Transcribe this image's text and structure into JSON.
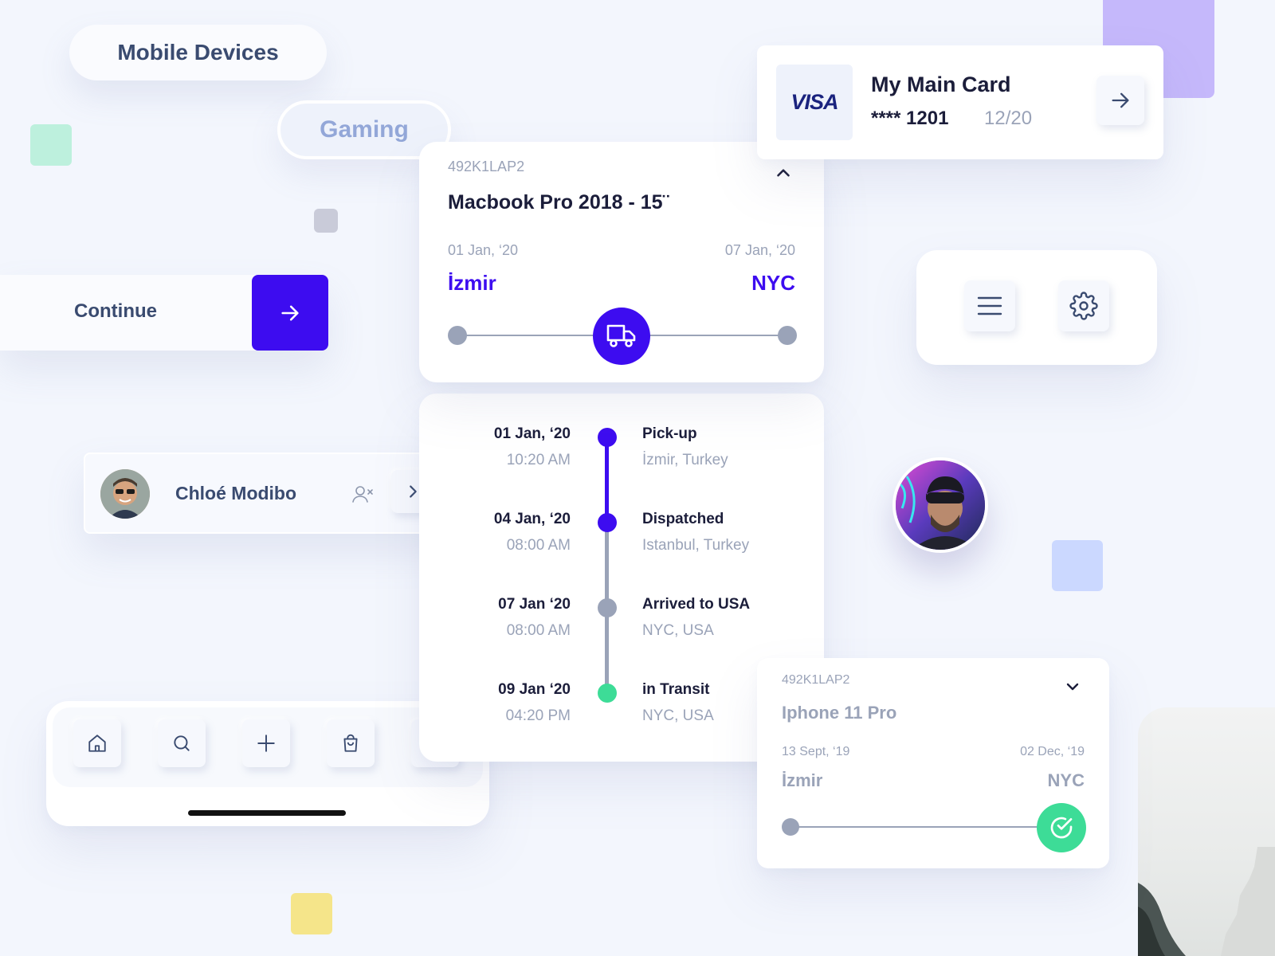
{
  "chips": {
    "mobile_devices": "Mobile Devices",
    "gaming": "Gaming"
  },
  "continue_button": {
    "label": "Continue"
  },
  "user_row": {
    "name": "Chloé Modibo"
  },
  "card_widget": {
    "brand": "VISA",
    "title": "My Main Card",
    "number": "**** 1201",
    "expiry": "12/20"
  },
  "shipment_main": {
    "code": "492K1LAP2",
    "product": "Macbook Pro 2018 - 15¨",
    "start_date": "01 Jan, ‘20",
    "end_date": "07 Jan, ‘20",
    "origin": "İzmir",
    "destination": "NYC",
    "progress": 0.5
  },
  "timeline": [
    {
      "date": "01 Jan, ‘20",
      "time": "10:20 AM",
      "status": "Pick-up",
      "location": "İzmir, Turkey",
      "state": "done"
    },
    {
      "date": "04 Jan, ‘20",
      "time": "08:00 AM",
      "status": "Dispatched",
      "location": "Istanbul, Turkey",
      "state": "done"
    },
    {
      "date": "07 Jan ‘20",
      "time": "08:00 AM",
      "status": "Arrived to USA",
      "location": "NYC, USA",
      "state": "pending"
    },
    {
      "date": "09 Jan ‘20",
      "time": "04:20 PM",
      "status": "in Transit",
      "location": "NYC, USA",
      "state": "current"
    }
  ],
  "shipment_secondary": {
    "code": "492K1LAP2",
    "product": "Iphone 11 Pro",
    "start_date": "13 Sept, ‘19",
    "end_date": "02 Dec, ‘19",
    "origin": "İzmir",
    "destination": "NYC",
    "progress": 1.0
  },
  "bottom_nav": {
    "items": [
      "home-icon",
      "search-icon",
      "plus-icon",
      "bag-icon",
      "user-icon"
    ]
  },
  "colors": {
    "accent": "#3d0cf0",
    "success": "#3ddc97",
    "muted": "#9aa3b8",
    "navy": "#3a4b70"
  }
}
